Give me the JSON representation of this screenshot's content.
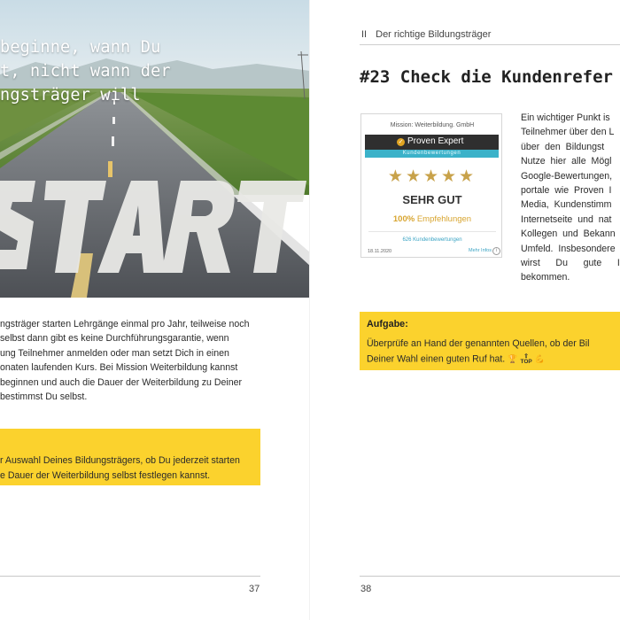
{
  "left_page": {
    "hero": {
      "quote_lines": [
        "beginne, wann Du",
        "t, nicht wann der",
        "ngsträger will"
      ],
      "road_text": "START"
    },
    "body": "ngsträger starten Lehrgänge einmal pro Jahr, teilweise noch\n selbst dann gibt es keine Durchführungsgarantie, wenn\nung Teilnehmer anmelden oder man setzt Dich in einen\nonaten laufenden Kurs. Bei Mission  Weiterbildung kannst\nbeginnen und auch die Dauer der Weiterbildung zu Deiner\nbestimmst Du selbst.",
    "task_text": "r Auswahl Deines Bildungsträgers, ob Du jederzeit starten\ne Dauer der Weiterbildung selbst festlegen kannst.",
    "page_number": "37"
  },
  "right_page": {
    "running_header": {
      "section_number": "II",
      "section_title": "Der richtige Bildungsträger"
    },
    "chapter_title": "#23 Check die Kundenrefer",
    "badge": {
      "company": "Mission: Weiterbildung. GmbH",
      "brand": "Proven Expert",
      "ribbon": "Kundenbewertungen",
      "stars": "★★★★★",
      "grade": "SEHR GUT",
      "recommend_percent": "100%",
      "recommend_label": "Empfehlungen",
      "review_count": "626 Kundenbewertungen",
      "date": "18.11.2020",
      "more_info": "Mehr Infos",
      "colors": {
        "bar": "#2f2f2f",
        "ribbon": "#3bb2c9",
        "stars": "#c8a24a",
        "recommend": "#d8a530"
      }
    },
    "body": "Ein wichtiger Punkt is\nTeilnehmer über den L\nüber  den  Bildungst\nNutze  hier  alle  Mögl\nGoogle-Bewertungen,\nportale  wie  Proven  I\nMedia,  Kundenstimm\nInternetseite  und  nat\nKollegen  und  Bekann\nUmfeld.  Insbesondere\nwirst      Du      gute      I\nbekommen.",
    "task": {
      "label": "Aufgabe:",
      "line1": "Überprüfe an Hand der genannten Quellen, ob der Bil",
      "line2": "Deiner Wahl einen guten Ruf hat.",
      "emoji_icons": [
        "trophy-icon",
        "top-icon",
        "flexed-arm-icon"
      ]
    },
    "page_number": "38"
  },
  "accent_color": "#fbd22d"
}
